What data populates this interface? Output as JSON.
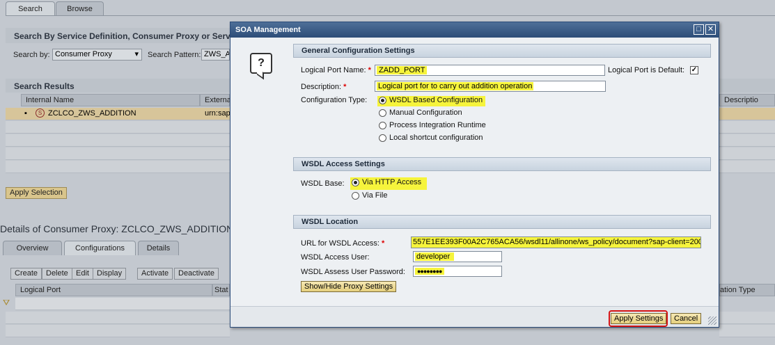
{
  "background": {
    "top_tabs": [
      {
        "label": "Search"
      },
      {
        "label": "Browse"
      }
    ],
    "search_title": "Search By Service Definition, Consumer Proxy or Service",
    "search_by_label": "Search by:",
    "search_by_value": "Consumer Proxy",
    "search_pattern_label": "Search Pattern:",
    "search_pattern_value": "ZWS_A",
    "results_title": "Search Results",
    "results_columns": [
      "Internal Name",
      "Externa",
      "Descriptio"
    ],
    "results_row": {
      "internal_name": "ZCLCO_ZWS_ADDITION",
      "external": "urn:sap"
    },
    "apply_selection": "Apply Selection",
    "details_title": "Details of Consumer Proxy: ZCLCO_ZWS_ADDITION",
    "detail_tabs": [
      {
        "label": "Overview"
      },
      {
        "label": "Configurations"
      },
      {
        "label": "Details"
      }
    ],
    "toolbar": [
      "Create",
      "Delete",
      "Edit",
      "Display",
      "Activate",
      "Deactivate"
    ],
    "config_columns": [
      "Logical Port",
      "Stat",
      "ation Type"
    ]
  },
  "dialog": {
    "title": "SOA Management",
    "help_icon_glyph": "?",
    "general": {
      "header": "General Configuration Settings",
      "logical_port_label": "Logical Port Name:",
      "logical_port_value": "ZADD_PORT",
      "default_label": "Logical Port is Default:",
      "default_checked": "✓",
      "description_label": "Description:",
      "description_value": "Logical port for to carry out addition operation",
      "config_type_label": "Configuration Type:",
      "config_options": [
        {
          "label": "WSDL Based Configuration"
        },
        {
          "label": "Manual Configuration"
        },
        {
          "label": "Process Integration Runtime"
        },
        {
          "label": "Local shortcut configuration"
        }
      ],
      "config_selected": "WSDL Based Configuration",
      "required_mark": "*"
    },
    "access": {
      "header": "WSDL Access Settings",
      "base_label": "WSDL Base:",
      "options": [
        {
          "label": "Via HTTP Access"
        },
        {
          "label": "Via File"
        }
      ],
      "selected": "Via HTTP Access"
    },
    "location": {
      "header": "WSDL Location",
      "url_label": "URL for WSDL Access:",
      "url_value": "557E1EE393F00A2C765ACA56/wsdl11/allinone/ws_policy/document?sap-client=200",
      "user_label": "WSDL Access User:",
      "user_value": "developer",
      "password_label": "WSDL Assess User Password:",
      "password_value": "●●●●●●●●",
      "proxy_button": "Show/Hide Proxy Settings"
    },
    "footer": {
      "apply": "Apply Settings",
      "cancel": "Cancel"
    },
    "highlight_color": "#f6f43c",
    "title_bar_color": "#2d4d78"
  }
}
